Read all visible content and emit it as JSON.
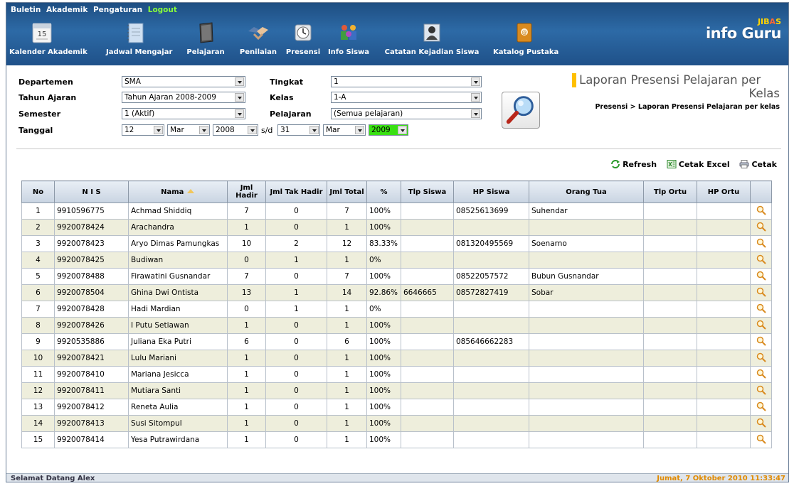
{
  "top_menu": {
    "buletin": "Buletin",
    "akademik": "Akademik",
    "pengaturan": "Pengaturan",
    "logout": "Logout"
  },
  "nav": {
    "items": [
      {
        "label": "Kalender Akademik",
        "icon": "calendar-icon",
        "calendar_day": "15"
      },
      {
        "label": "Jadwal Mengajar",
        "icon": "notebook-icon"
      },
      {
        "label": "Pelajaran",
        "icon": "book-icon"
      },
      {
        "label": "Penilaian",
        "icon": "handshake-icon"
      },
      {
        "label": "Presensi",
        "icon": "clock-icon"
      },
      {
        "label": "Info Siswa",
        "icon": "students-icon"
      },
      {
        "label": "Catatan Kejadian Siswa",
        "icon": "person-card-icon"
      },
      {
        "label": "Katalog Pustaka",
        "icon": "address-book-icon"
      }
    ]
  },
  "brand": {
    "top_a": "JIB",
    "top_b": "A",
    "top_c": "S",
    "name": "info Guru"
  },
  "filters": {
    "departemen_label": "Departemen",
    "departemen_value": "SMA",
    "tahun_label": "Tahun Ajaran",
    "tahun_value": "Tahun Ajaran 2008-2009",
    "semester_label": "Semester",
    "semester_value": "1 (Aktif)",
    "tanggal_label": "Tanggal",
    "tgl_from_day": "12",
    "tgl_from_month": "Mar",
    "tgl_from_year": "2008",
    "sd": "s/d",
    "tgl_to_day": "31",
    "tgl_to_month": "Mar",
    "tgl_to_year": "2009",
    "tingkat_label": "Tingkat",
    "tingkat_value": "1",
    "kelas_label": "Kelas",
    "kelas_value": "1-A",
    "pelajaran_label": "Pelajaran",
    "pelajaran_value": "(Semua pelajaran)"
  },
  "heading": {
    "title_line1": "Laporan Presensi Pelajaran per",
    "title_line2": "Kelas",
    "breadcrumb": "Presensi  >  Laporan Presensi Pelajaran per kelas"
  },
  "actions": {
    "refresh": "Refresh",
    "excel": "Cetak Excel",
    "print": "Cetak"
  },
  "table": {
    "headers": [
      "No",
      "N I S",
      "Nama",
      "Jml Hadir",
      "Jml Tak Hadir",
      "Jml Total",
      "%",
      "Tlp Siswa",
      "HP Siswa",
      "Orang Tua",
      "Tlp Ortu",
      "HP Ortu"
    ],
    "rows": [
      [
        "1",
        "9910596775",
        "Achmad Shiddiq",
        "7",
        "0",
        "7",
        "100%",
        "",
        "08525613699",
        "Suhendar",
        "",
        ""
      ],
      [
        "2",
        "9920078424",
        "Arachandra",
        "1",
        "0",
        "1",
        "100%",
        "",
        "",
        "",
        "",
        ""
      ],
      [
        "3",
        "9920078423",
        "Aryo Dimas Pamungkas",
        "10",
        "2",
        "12",
        "83.33%",
        "",
        "081320495569",
        "Soenarno",
        "",
        ""
      ],
      [
        "4",
        "9920078425",
        "Budiwan",
        "0",
        "1",
        "1",
        "0%",
        "",
        "",
        "",
        "",
        ""
      ],
      [
        "5",
        "9920078488",
        "Firawatini Gusnandar",
        "7",
        "0",
        "7",
        "100%",
        "",
        "08522057572",
        "Bubun Gusnandar",
        "",
        ""
      ],
      [
        "6",
        "9920078504",
        "Ghina Dwi Ontista",
        "13",
        "1",
        "14",
        "92.86%",
        "6646665",
        "08572827419",
        "Sobar",
        "",
        ""
      ],
      [
        "7",
        "9920078428",
        "Hadi Mardian",
        "0",
        "1",
        "1",
        "0%",
        "",
        "",
        "",
        "",
        ""
      ],
      [
        "8",
        "9920078426",
        "I Putu Setiawan",
        "1",
        "0",
        "1",
        "100%",
        "",
        "",
        "",
        "",
        ""
      ],
      [
        "9",
        "9920535886",
        "Juliana Eka Putri",
        "6",
        "0",
        "6",
        "100%",
        "",
        "085646662283",
        "",
        "",
        ""
      ],
      [
        "10",
        "9920078421",
        "Lulu Mariani",
        "1",
        "0",
        "1",
        "100%",
        "",
        "",
        "",
        "",
        ""
      ],
      [
        "11",
        "9920078410",
        "Mariana Jesicca",
        "1",
        "0",
        "1",
        "100%",
        "",
        "",
        "",
        "",
        ""
      ],
      [
        "12",
        "9920078411",
        "Mutiara Santi",
        "1",
        "0",
        "1",
        "100%",
        "",
        "",
        "",
        "",
        ""
      ],
      [
        "13",
        "9920078412",
        "Reneta Aulia",
        "1",
        "0",
        "1",
        "100%",
        "",
        "",
        "",
        "",
        ""
      ],
      [
        "14",
        "9920078413",
        "Susi Sitompul",
        "1",
        "0",
        "1",
        "100%",
        "",
        "",
        "",
        "",
        ""
      ],
      [
        "15",
        "9920078414",
        "Yesa Putrawirdana",
        "1",
        "0",
        "1",
        "100%",
        "",
        "",
        "",
        "",
        ""
      ]
    ]
  },
  "footer": {
    "welcome": "Selamat Datang Alex",
    "datetime": "Jumat, 7 Oktober 2010 11:33:47"
  },
  "colors": {
    "header_blue": "#2d6aa6",
    "alt_row": "#eeeedc",
    "logout": "#8aff3a",
    "accent_yellow": "#ffc000",
    "year_highlight": "#39e012"
  }
}
